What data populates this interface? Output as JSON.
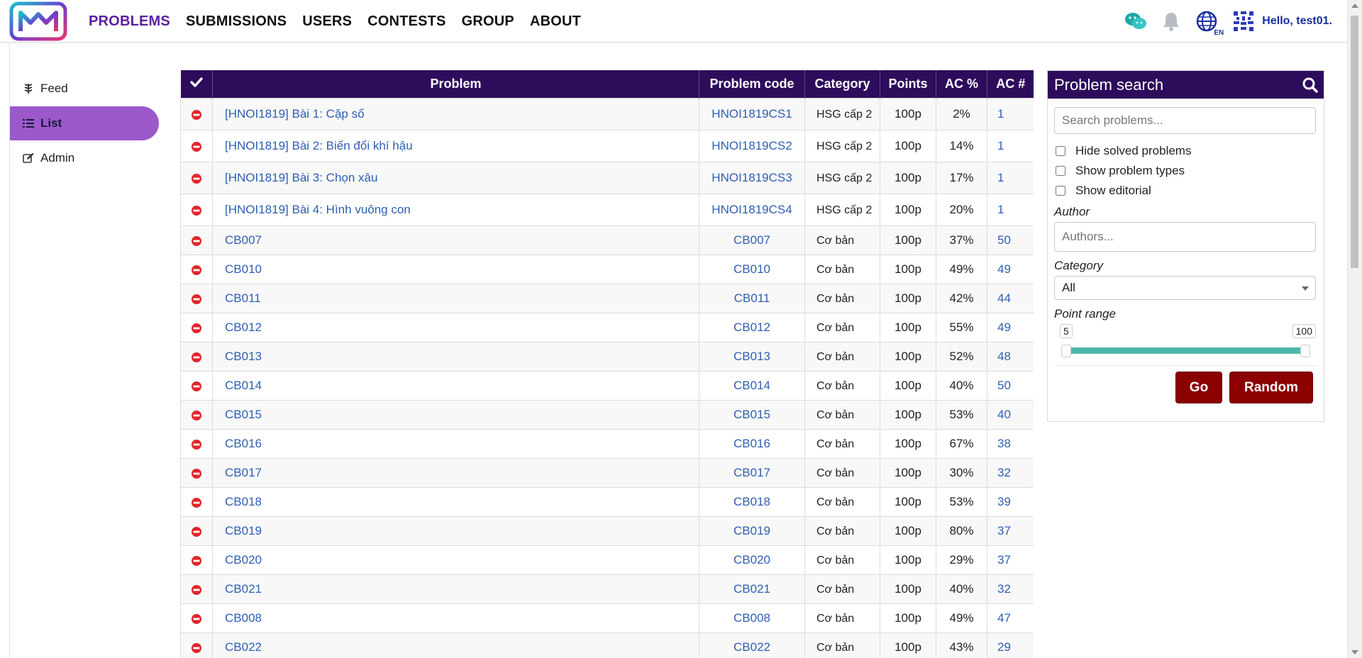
{
  "nav": {
    "items": [
      {
        "label": "PROBLEMS",
        "active": true
      },
      {
        "label": "SUBMISSIONS",
        "active": false
      },
      {
        "label": "USERS",
        "active": false
      },
      {
        "label": "CONTESTS",
        "active": false
      },
      {
        "label": "GROUP",
        "active": false
      },
      {
        "label": "ABOUT",
        "active": false
      }
    ],
    "lang_badge": "EN",
    "greeting": "Hello, test01."
  },
  "sidebar": {
    "items": [
      {
        "label": "Feed",
        "icon": "feed-icon",
        "active": false
      },
      {
        "label": "List",
        "icon": "list-icon",
        "active": true
      },
      {
        "label": "Admin",
        "icon": "edit-icon",
        "active": false
      }
    ]
  },
  "table": {
    "headers": {
      "status": "✔",
      "problem": "Problem",
      "code": "Problem code",
      "category": "Category",
      "points": "Points",
      "ac_pct": "AC %",
      "ac_count": "AC #"
    },
    "rows": [
      {
        "name": "[HNOI1819] Bài 1: Cặp số",
        "code": "HNOI1819CS1",
        "category": "HSG cấp 2",
        "points": "100p",
        "ac_pct": "2%",
        "ac_count": "1"
      },
      {
        "name": "[HNOI1819] Bài 2: Biến đổi khí hậu",
        "code": "HNOI1819CS2",
        "category": "HSG cấp 2",
        "points": "100p",
        "ac_pct": "14%",
        "ac_count": "1"
      },
      {
        "name": "[HNOI1819] Bài 3: Chọn xâu",
        "code": "HNOI1819CS3",
        "category": "HSG cấp 2",
        "points": "100p",
        "ac_pct": "17%",
        "ac_count": "1"
      },
      {
        "name": "[HNOI1819] Bài 4: Hình vuông con",
        "code": "HNOI1819CS4",
        "category": "HSG cấp 2",
        "points": "100p",
        "ac_pct": "20%",
        "ac_count": "1"
      },
      {
        "name": "CB007",
        "code": "CB007",
        "category": "Cơ bản",
        "points": "100p",
        "ac_pct": "37%",
        "ac_count": "50"
      },
      {
        "name": "CB010",
        "code": "CB010",
        "category": "Cơ bản",
        "points": "100p",
        "ac_pct": "49%",
        "ac_count": "49"
      },
      {
        "name": "CB011",
        "code": "CB011",
        "category": "Cơ bản",
        "points": "100p",
        "ac_pct": "42%",
        "ac_count": "44"
      },
      {
        "name": "CB012",
        "code": "CB012",
        "category": "Cơ bản",
        "points": "100p",
        "ac_pct": "55%",
        "ac_count": "49"
      },
      {
        "name": "CB013",
        "code": "CB013",
        "category": "Cơ bản",
        "points": "100p",
        "ac_pct": "52%",
        "ac_count": "48"
      },
      {
        "name": "CB014",
        "code": "CB014",
        "category": "Cơ bản",
        "points": "100p",
        "ac_pct": "40%",
        "ac_count": "50"
      },
      {
        "name": "CB015",
        "code": "CB015",
        "category": "Cơ bản",
        "points": "100p",
        "ac_pct": "53%",
        "ac_count": "40"
      },
      {
        "name": "CB016",
        "code": "CB016",
        "category": "Cơ bản",
        "points": "100p",
        "ac_pct": "67%",
        "ac_count": "38"
      },
      {
        "name": "CB017",
        "code": "CB017",
        "category": "Cơ bản",
        "points": "100p",
        "ac_pct": "30%",
        "ac_count": "32"
      },
      {
        "name": "CB018",
        "code": "CB018",
        "category": "Cơ bản",
        "points": "100p",
        "ac_pct": "53%",
        "ac_count": "39"
      },
      {
        "name": "CB019",
        "code": "CB019",
        "category": "Cơ bản",
        "points": "100p",
        "ac_pct": "80%",
        "ac_count": "37"
      },
      {
        "name": "CB020",
        "code": "CB020",
        "category": "Cơ bản",
        "points": "100p",
        "ac_pct": "29%",
        "ac_count": "37"
      },
      {
        "name": "CB021",
        "code": "CB021",
        "category": "Cơ bản",
        "points": "100p",
        "ac_pct": "40%",
        "ac_count": "32"
      },
      {
        "name": "CB008",
        "code": "CB008",
        "category": "Cơ bản",
        "points": "100p",
        "ac_pct": "49%",
        "ac_count": "47"
      },
      {
        "name": "CB022",
        "code": "CB022",
        "category": "Cơ bản",
        "points": "100p",
        "ac_pct": "43%",
        "ac_count": "29"
      }
    ]
  },
  "search": {
    "title": "Problem search",
    "placeholder": "Search problems...",
    "hide_solved": "Hide solved problems",
    "show_types": "Show problem types",
    "show_editorial": "Show editorial",
    "author_label": "Author",
    "author_placeholder": "Authors...",
    "category_label": "Category",
    "category_value": "All",
    "point_range_label": "Point range",
    "range_min": "5",
    "range_max": "100",
    "go_label": "Go",
    "random_label": "Random"
  },
  "colors": {
    "header_bg": "#2d0c5c",
    "nav_active": "#5a1fa0",
    "sidebar_active": "#9b59c9",
    "link": "#2f5fb0",
    "button": "#8b0000",
    "range": "#4fb6ad",
    "status_red": "#e0262b"
  }
}
